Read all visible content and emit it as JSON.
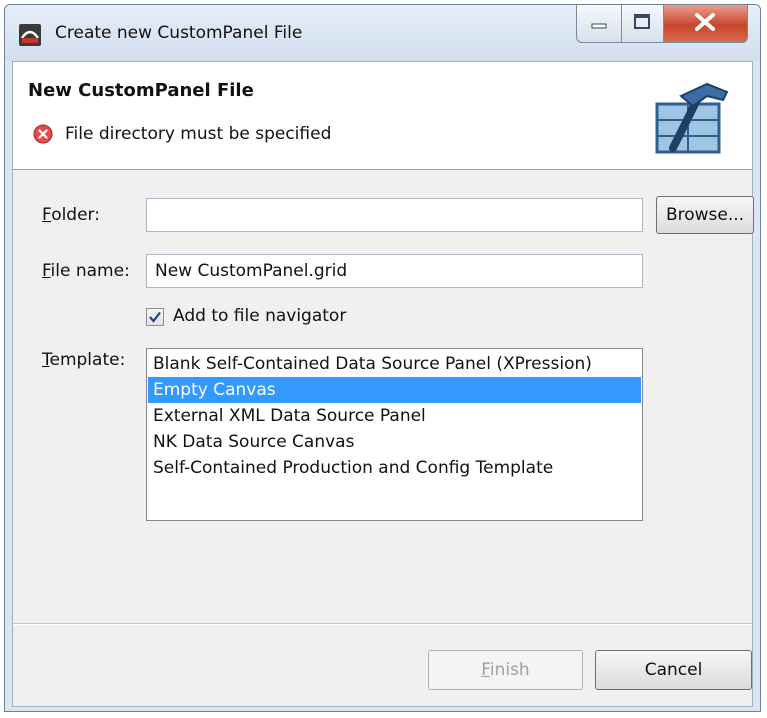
{
  "window": {
    "title": "Create new CustomPanel File",
    "controls": {
      "minimize": "minimize-icon",
      "maximize": "maximize-icon",
      "close": "close-icon"
    }
  },
  "banner": {
    "title": "New CustomPanel File",
    "error_icon": "error-icon",
    "error_text": "File directory must be specified",
    "wizard_icon": "hammer-window-icon"
  },
  "form": {
    "folder": {
      "label_mnemonic": "F",
      "label_rest": "older:",
      "value": ""
    },
    "browse_label": "Browse...",
    "file_name": {
      "label_mnemonic": "F",
      "label_rest": "ile name:",
      "value": "New CustomPanel.grid"
    },
    "add_to_navigator": {
      "label": "Add to file navigator",
      "checked": true
    },
    "template": {
      "label_mnemonic": "T",
      "label_rest": "emplate:",
      "items": [
        "Blank Self-Contained Data Source Panel (XPression)",
        "Empty Canvas",
        "External XML Data Source Panel",
        "NK Data Source Canvas",
        "Self-Contained Production and Config Template"
      ],
      "selected_index": 1
    }
  },
  "buttons": {
    "finish_mnemonic": "F",
    "finish_rest": "inish",
    "cancel": "Cancel"
  },
  "colors": {
    "selection": "#3399ff",
    "error": "#e04b4b",
    "close_button": "#c8452c"
  }
}
